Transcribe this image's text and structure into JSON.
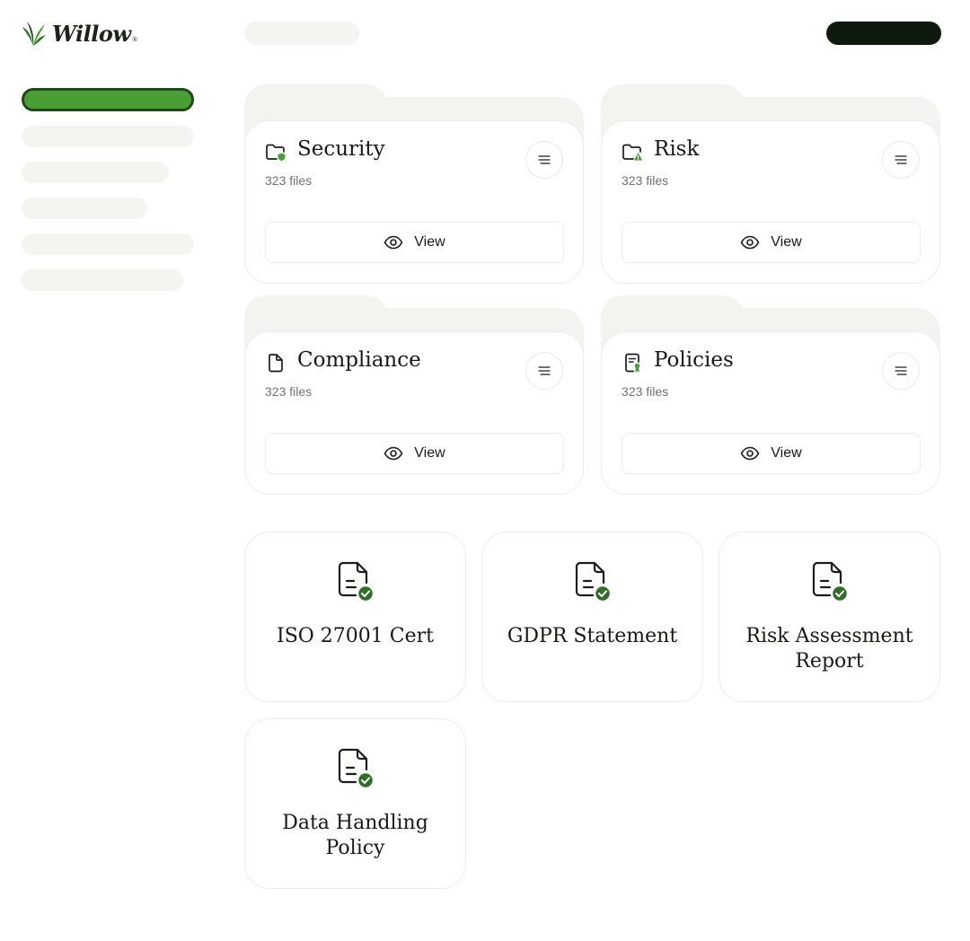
{
  "brand": {
    "name": "Willow",
    "mark": "®"
  },
  "folders": [
    {
      "title": "Security",
      "count": "323 files",
      "view_label": "View",
      "icon": "folder-shield-icon"
    },
    {
      "title": "Risk",
      "count": "323 files",
      "view_label": "View",
      "icon": "folder-warning-icon"
    },
    {
      "title": "Compliance",
      "count": "323 files",
      "view_label": "View",
      "icon": "file-icon"
    },
    {
      "title": "Policies",
      "count": "323 files",
      "view_label": "View",
      "icon": "document-badge-icon"
    }
  ],
  "documents": [
    {
      "title": "ISO 27001 Cert"
    },
    {
      "title": "GDPR Statement"
    },
    {
      "title": "Risk Assessment Report"
    },
    {
      "title": "Data Handling Policy"
    }
  ],
  "colors": {
    "accent": "#4a9e36",
    "accent_dark": "#1f4a17",
    "check": "#2f6f27",
    "ink": "#161a15"
  }
}
